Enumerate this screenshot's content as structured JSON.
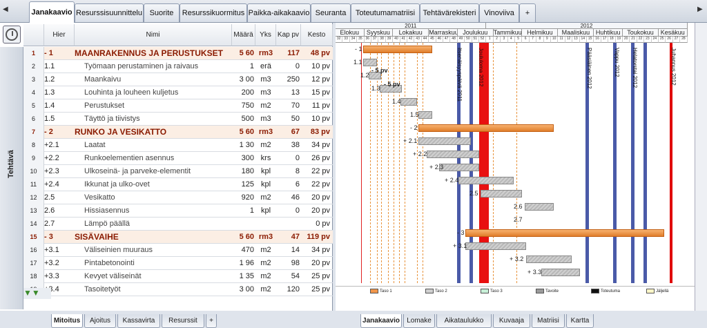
{
  "tabs": [
    {
      "label": "Janakaavio",
      "active": true
    },
    {
      "label": "Resurssisuunnittelu"
    },
    {
      "label": "Suorite"
    },
    {
      "label": "Resurssikuormitus"
    },
    {
      "label": "Paikka-aikakaavio"
    },
    {
      "label": "Seuranta"
    },
    {
      "label": "Toteutumamatriisi"
    },
    {
      "label": "Tehtävärekisteri"
    },
    {
      "label": "Vinoviiva"
    },
    {
      "label": "+"
    }
  ],
  "side_label": "Tehtävä",
  "columns": {
    "hier": "Hier",
    "name": "Nimi",
    "maara": "Määrä",
    "yks": "Yks",
    "kap": "Kap pv",
    "kesto": "Kesto"
  },
  "rows": [
    {
      "n": "1",
      "hier": "- 1",
      "name": "MAANRAKENNUS JA PERUSTUKSET",
      "maara": "5 60",
      "yks": "rm3",
      "kap": "117",
      "kesto": "48 pv",
      "sum": true
    },
    {
      "n": "2",
      "hier": "1.1",
      "name": "Työmaan perustaminen ja raivaus",
      "maara": "1",
      "yks": "erä",
      "kap": "0",
      "kesto": "10 pv"
    },
    {
      "n": "3",
      "hier": "1.2",
      "name": "Maankaivu",
      "maara": "3 00",
      "yks": "m3",
      "kap": "250",
      "kesto": "12 pv"
    },
    {
      "n": "4",
      "hier": "1.3",
      "name": "Louhinta ja louheen kuljetus",
      "maara": "200",
      "yks": "m3",
      "kap": "13",
      "kesto": "15 pv"
    },
    {
      "n": "5",
      "hier": "1.4",
      "name": "Perustukset",
      "maara": "750",
      "yks": "m2",
      "kap": "70",
      "kesto": "11 pv"
    },
    {
      "n": "6",
      "hier": "1.5",
      "name": "Täyttö ja tiivistys",
      "maara": "500",
      "yks": "m3",
      "kap": "50",
      "kesto": "10 pv"
    },
    {
      "n": "7",
      "hier": "- 2",
      "name": "RUNKO JA VESIKATTO",
      "maara": "5 60",
      "yks": "rm3",
      "kap": "67",
      "kesto": "83 pv",
      "sum": true
    },
    {
      "n": "8",
      "hier": "+2.1",
      "name": "Laatat",
      "maara": "1 30",
      "yks": "m2",
      "kap": "38",
      "kesto": "34 pv"
    },
    {
      "n": "9",
      "hier": "+2.2",
      "name": "Runkoelementien asennus",
      "maara": "300",
      "yks": "krs",
      "kap": "0",
      "kesto": "26 pv"
    },
    {
      "n": "10",
      "hier": "+2.3",
      "name": "Ulkoseinä- ja parveke-elementit",
      "maara": "180",
      "yks": "kpl",
      "kap": "8",
      "kesto": "22 pv"
    },
    {
      "n": "11",
      "hier": "+2.4",
      "name": "Ikkunat ja ulko-ovet",
      "maara": "125",
      "yks": "kpl",
      "kap": "6",
      "kesto": "22 pv"
    },
    {
      "n": "12",
      "hier": "2.5",
      "name": "Vesikatto",
      "maara": "920",
      "yks": "m2",
      "kap": "46",
      "kesto": "20 pv"
    },
    {
      "n": "13",
      "hier": "2.6",
      "name": "Hissiasennus",
      "maara": "1",
      "yks": "kpl",
      "kap": "0",
      "kesto": "20 pv"
    },
    {
      "n": "14",
      "hier": "2.7",
      "name": "Lämpö päällä",
      "maara": "",
      "yks": "",
      "kap": "",
      "kesto": "0 pv"
    },
    {
      "n": "15",
      "hier": "- 3",
      "name": "SISÄVAIHE",
      "maara": "5 60",
      "yks": "rm3",
      "kap": "47",
      "kesto": "119 pv",
      "sum": true
    },
    {
      "n": "16",
      "hier": "+3.1",
      "name": "Väliseinien muuraus",
      "maara": "470",
      "yks": "m2",
      "kap": "14",
      "kesto": "34 pv"
    },
    {
      "n": "17",
      "hier": "+3.2",
      "name": "Pintabetonointi",
      "maara": "1 96",
      "yks": "m2",
      "kap": "98",
      "kesto": "20 pv"
    },
    {
      "n": "18",
      "hier": "+3.3",
      "name": "Kevyet väliseinät",
      "maara": "1 35",
      "yks": "m2",
      "kap": "54",
      "kesto": "25 pv"
    },
    {
      "n": "19",
      "hier": "+3.4",
      "name": "Tasoitetyöt",
      "maara": "3 00",
      "yks": "m2",
      "kap": "120",
      "kesto": "25 pv"
    }
  ],
  "left_bottom_tabs": [
    {
      "label": "Mitoitus",
      "active": true
    },
    {
      "label": "Ajoitus"
    },
    {
      "label": "Kassavirta"
    },
    {
      "label": "Resurssit"
    },
    {
      "label": "+"
    }
  ],
  "right_bottom_tabs": [
    {
      "label": "Janakaavio",
      "active": true
    },
    {
      "label": "Lomake"
    },
    {
      "label": "Aikataulukko"
    },
    {
      "label": "Kuvaaja"
    },
    {
      "label": "Matriisi"
    },
    {
      "label": "Kartta"
    }
  ],
  "years": [
    {
      "label": "2011"
    },
    {
      "label": "2012"
    }
  ],
  "months": [
    "Elokuu",
    "Syyskuu",
    "Lokakuu",
    "Marraskuu",
    "Joulukuu",
    "Tammikuu",
    "Helmikuu",
    "Maaliskuu",
    "Huhtikuu",
    "Toukokuu",
    "Kesäkuu"
  ],
  "weeks": [
    "32",
    "33",
    "34",
    "35",
    "36",
    "37",
    "38",
    "39",
    "40",
    "41",
    "42",
    "43",
    "44",
    "45",
    "46",
    "47",
    "48",
    "49",
    "50",
    "51",
    "52",
    "1",
    "2",
    "3",
    "4",
    "5",
    "6",
    "7",
    "8",
    "9",
    "10",
    "11",
    "12",
    "13",
    "14",
    "15",
    "16",
    "17",
    "18",
    "19",
    "20",
    "21",
    "22",
    "23",
    "24",
    "25",
    "26",
    "27",
    "28"
  ],
  "gantt_labels": [
    "- 1",
    "1.1",
    "- 5 pv",
    "1.2",
    "- 5 pv",
    "1.3",
    "1.4",
    "1.5",
    "- 2",
    "+ 2.1",
    "+ 2.2",
    "+ 2.3",
    "+ 2.4",
    "2.5",
    "2.6",
    "2.7",
    "- 3",
    "+ 3.1",
    "+ 3.2",
    "+ 3.3"
  ],
  "milestones": [
    "Itsenäisyyspäivä 2011",
    "Joululoma 2012",
    "Pääsiäinen 2012",
    "Vappu 2012",
    "Helatorstai 2012",
    "Juhannus 2012"
  ],
  "legend": [
    {
      "label": "Taso 1",
      "color": "#f0954a"
    },
    {
      "label": "Taso 2",
      "color": "#cfcfcf"
    },
    {
      "label": "Taso 3",
      "color": "#c8f0d8"
    },
    {
      "label": "Tavoite",
      "color": "#9a9a9a"
    },
    {
      "label": "Toteutuma",
      "color": "#111111"
    },
    {
      "label": "Jäljellä",
      "color": "#fff6c8"
    }
  ]
}
